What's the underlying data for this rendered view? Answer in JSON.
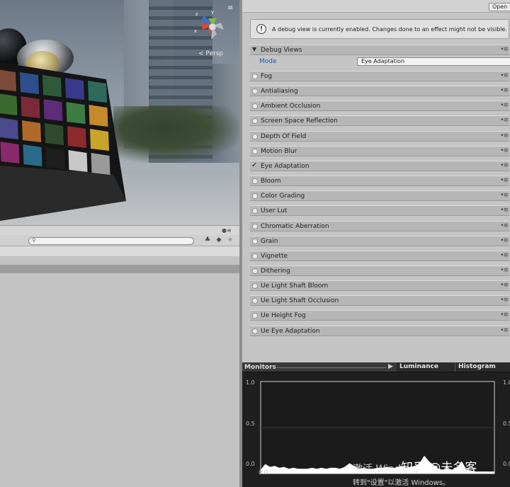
{
  "scene": {
    "projection_label": "< Persp",
    "menu_glyph": "≡",
    "axes": {
      "x": "x",
      "y": "y",
      "z": "z"
    }
  },
  "left_panel": {
    "lock_glyph": "🔒",
    "search": {
      "placeholder": ""
    },
    "tool_buttons": [
      "♣",
      "◆",
      "★"
    ]
  },
  "inspector": {
    "open_button": "Open",
    "info": {
      "icon": "!",
      "text": "A debug view is currently enabled. Changes done to an effect might not be visible."
    },
    "debug_views": {
      "label": "Debug Views",
      "mode_label": "Mode",
      "mode_value": "Eye Adaptation"
    },
    "menu_glyph": "•≡",
    "effects": [
      {
        "name": "Fog",
        "enabled": false
      },
      {
        "name": "Antialiasing",
        "enabled": false
      },
      {
        "name": "Ambient Occlusion",
        "enabled": false
      },
      {
        "name": "Screen Space Reflection",
        "enabled": false
      },
      {
        "name": "Depth Of Field",
        "enabled": false
      },
      {
        "name": "Motion Blur",
        "enabled": false
      },
      {
        "name": "Eye Adaptation",
        "enabled": true
      },
      {
        "name": "Bloom",
        "enabled": false
      },
      {
        "name": "Color Grading",
        "enabled": false
      },
      {
        "name": "User Lut",
        "enabled": false
      },
      {
        "name": "Chromatic Aberration",
        "enabled": false
      },
      {
        "name": "Grain",
        "enabled": false
      },
      {
        "name": "Vignette",
        "enabled": false
      },
      {
        "name": "Dithering",
        "enabled": false
      },
      {
        "name": "Ue Light Shaft Bloom",
        "enabled": false
      },
      {
        "name": "Ue Light Shaft Occlusion",
        "enabled": false
      },
      {
        "name": "Ue Height Fog",
        "enabled": false
      },
      {
        "name": "Ue Eye Adaptation",
        "enabled": false
      }
    ]
  },
  "monitors": {
    "title": "Monitors",
    "play_glyph": "▶",
    "tab_luminance": "Luminance",
    "tab_histogram": "Histogram",
    "y_ticks": [
      "1.0",
      "0.5",
      "0.0"
    ],
    "x_tick": "0.0",
    "right_ticks": [
      "1.0",
      "0.5",
      "0.0"
    ]
  },
  "chart_data": {
    "type": "area",
    "x": [
      0.0,
      0.02,
      0.04,
      0.06,
      0.08,
      0.1,
      0.12,
      0.14,
      0.16,
      0.18,
      0.2,
      0.22,
      0.24,
      0.26,
      0.28,
      0.3,
      0.32,
      0.34,
      0.36,
      0.38,
      0.4,
      0.42,
      0.44,
      0.46,
      0.48,
      0.5,
      0.52,
      0.54,
      0.56,
      0.58,
      0.6,
      0.62,
      0.64,
      0.66,
      0.68,
      0.7,
      0.72,
      0.74,
      0.76,
      0.78,
      0.8,
      0.82,
      0.84,
      0.86,
      0.88,
      0.9,
      0.92,
      0.94,
      0.96,
      0.98,
      1.0
    ],
    "values": [
      0.04,
      0.1,
      0.07,
      0.08,
      0.06,
      0.07,
      0.05,
      0.06,
      0.05,
      0.05,
      0.05,
      0.06,
      0.05,
      0.06,
      0.05,
      0.06,
      0.06,
      0.05,
      0.07,
      0.11,
      0.08,
      0.05,
      0.06,
      0.05,
      0.05,
      0.06,
      0.06,
      0.07,
      0.06,
      0.06,
      0.08,
      0.06,
      0.07,
      0.08,
      0.11,
      0.19,
      0.13,
      0.09,
      0.05,
      0.04,
      0.05,
      0.04,
      0.06,
      0.13,
      0.04,
      0.03,
      0.02,
      0.02,
      0.02,
      0.02,
      0.02
    ],
    "ylim": [
      0,
      1
    ],
    "xlim": [
      0,
      1
    ],
    "title": "",
    "xlabel": "",
    "ylabel": ""
  },
  "watermark": {
    "activate_line1": "激活 Windows",
    "activate_line2": "转到\"设置\"以激活 Windows。",
    "author": "知乎 @未名客"
  }
}
